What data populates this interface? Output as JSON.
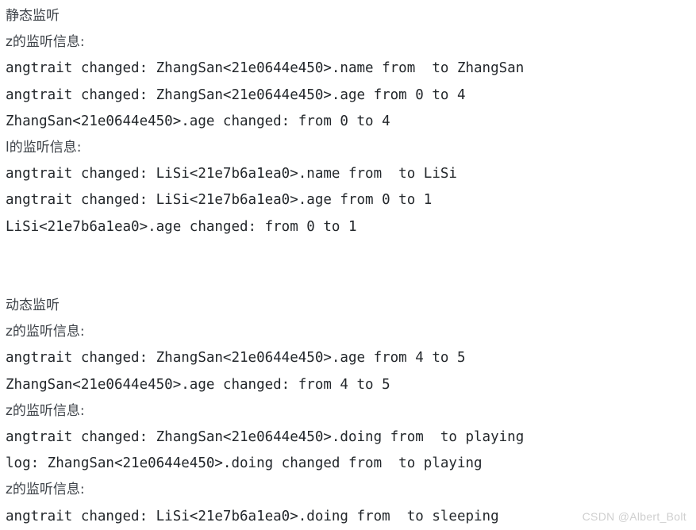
{
  "page": {
    "background_color": "#ffffff",
    "text_color": "#23272b",
    "label_color": "#3d4248",
    "watermark_color": "#cfcfcf"
  },
  "console": {
    "lines": [
      {
        "kind": "cjk",
        "text": "静态监听"
      },
      {
        "kind": "cjk",
        "text": "z的监听信息:"
      },
      {
        "kind": "mono",
        "text": "angtrait changed: ZhangSan<21e0644e450>.name from  to ZhangSan"
      },
      {
        "kind": "mono",
        "text": "angtrait changed: ZhangSan<21e0644e450>.age from 0 to 4"
      },
      {
        "kind": "mono",
        "text": "ZhangSan<21e0644e450>.age changed: from 0 to 4"
      },
      {
        "kind": "cjk",
        "text": "l的监听信息:"
      },
      {
        "kind": "mono",
        "text": "angtrait changed: LiSi<21e7b6a1ea0>.name from  to LiSi"
      },
      {
        "kind": "mono",
        "text": "angtrait changed: LiSi<21e7b6a1ea0>.age from 0 to 1"
      },
      {
        "kind": "mono",
        "text": "LiSi<21e7b6a1ea0>.age changed: from 0 to 1"
      },
      {
        "kind": "blank",
        "text": " "
      },
      {
        "kind": "blank",
        "text": " "
      },
      {
        "kind": "cjk",
        "text": "动态监听"
      },
      {
        "kind": "cjk",
        "text": "z的监听信息:"
      },
      {
        "kind": "mono",
        "text": "angtrait changed: ZhangSan<21e0644e450>.age from 4 to 5"
      },
      {
        "kind": "mono",
        "text": "ZhangSan<21e0644e450>.age changed: from 4 to 5"
      },
      {
        "kind": "cjk",
        "text": "z的监听信息:"
      },
      {
        "kind": "mono",
        "text": "angtrait changed: ZhangSan<21e0644e450>.doing from  to playing"
      },
      {
        "kind": "mono",
        "text": "log: ZhangSan<21e0644e450>.doing changed from  to playing"
      },
      {
        "kind": "cjk",
        "text": "z的监听信息:"
      },
      {
        "kind": "mono",
        "text": "angtrait changed: LiSi<21e7b6a1ea0>.doing from  to sleeping"
      }
    ]
  },
  "watermark": {
    "text": "CSDN @Albert_Bolt"
  }
}
